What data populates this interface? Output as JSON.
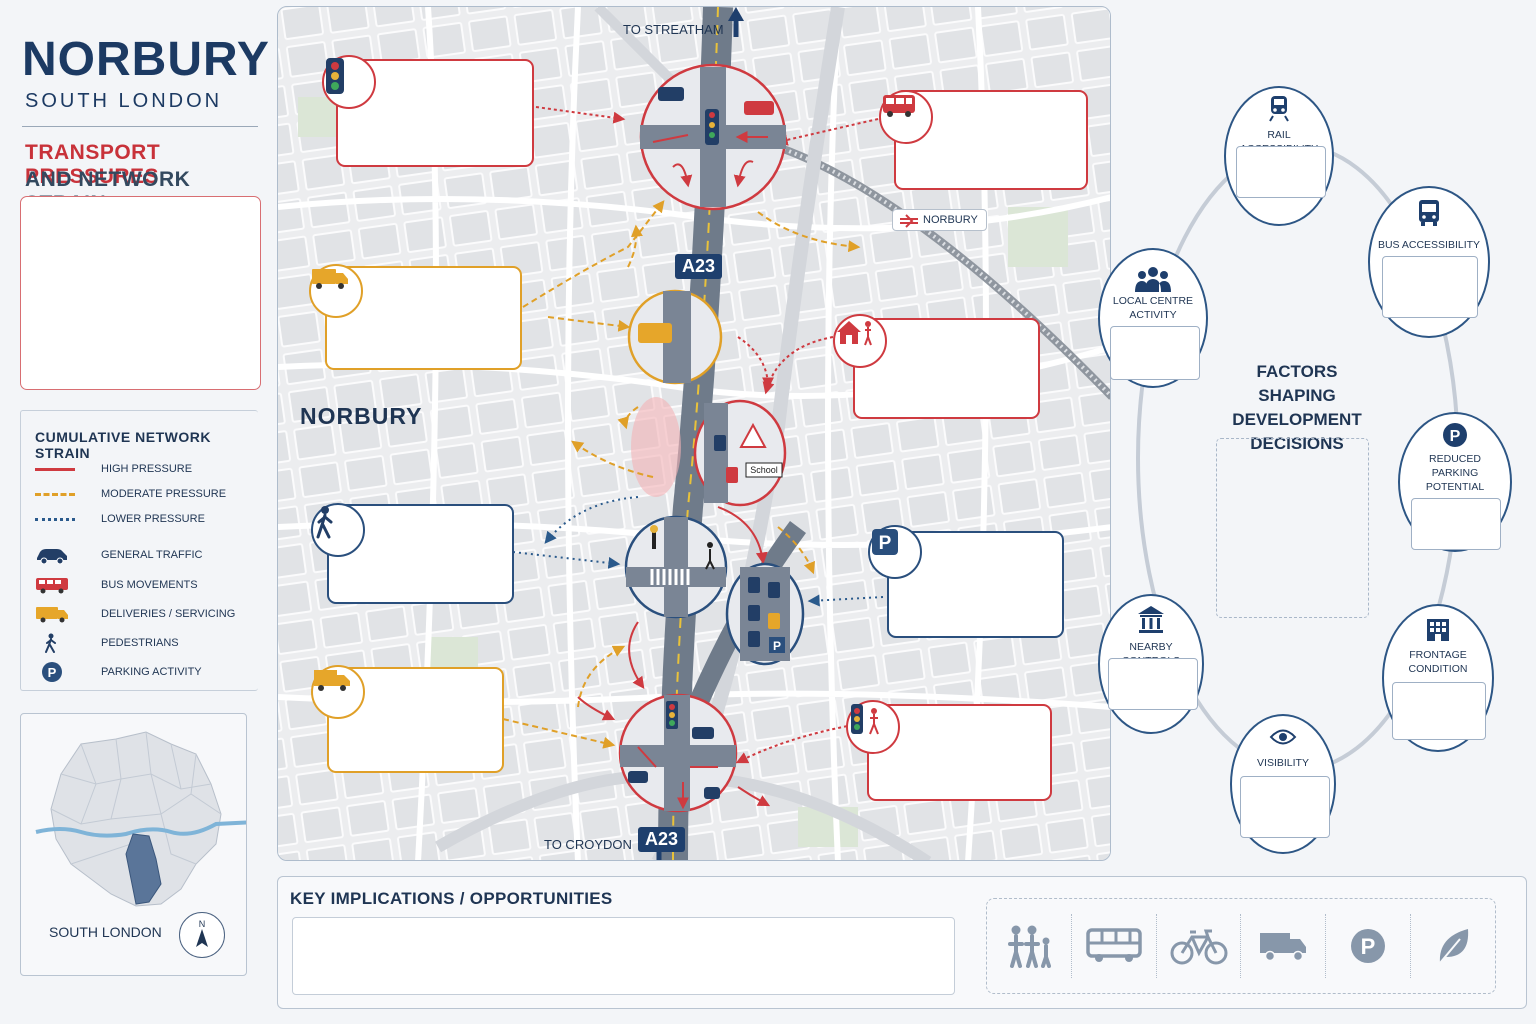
{
  "header": {
    "title": "NORBURY",
    "subtitle": "SOUTH LONDON",
    "heading_red": "TRANSPORT PRESSURES",
    "heading_blue": "AND NETWORK STRAIN"
  },
  "legend": {
    "title": "CUMULATIVE NETWORK STRAIN",
    "items": [
      {
        "label": "HIGH PRESSURE",
        "icon": "solid-red-line",
        "color": "#cf3a40"
      },
      {
        "label": "MODERATE PRESSURE",
        "icon": "dashed-orange-line",
        "color": "#e0a028"
      },
      {
        "label": "LOWER PRESSURE",
        "icon": "dotted-blue-line",
        "color": "#2a5a8c"
      },
      {
        "label": "GENERAL TRAFFIC",
        "icon": "car-icon",
        "color": "#2a4f7d"
      },
      {
        "label": "BUS MOVEMENTS",
        "icon": "bus-icon",
        "color": "#cf3a40"
      },
      {
        "label": "DELIVERIES / SERVICING",
        "icon": "van-icon",
        "color": "#e0a028"
      },
      {
        "label": "PEDESTRIANS",
        "icon": "pedestrian-icon",
        "color": "#2a4f7d"
      },
      {
        "label": "PARKING ACTIVITY",
        "icon": "parking-icon",
        "color": "#2a4f7d"
      }
    ]
  },
  "minimap": {
    "label": "SOUTH LONDON",
    "north_label": "N"
  },
  "map": {
    "place_name": "NORBURY",
    "to_north": "TO STREATHAM",
    "to_south": "TO CROYDON",
    "road_mid": "A23",
    "road_bottom": "A23",
    "station": "NORBURY",
    "school_sign": "School",
    "callouts": [
      {
        "id": "signals-north",
        "color": "red",
        "icon": "traffic-light-icon"
      },
      {
        "id": "bus-north",
        "color": "red",
        "icon": "bus-icon"
      },
      {
        "id": "deliveries-north",
        "color": "orange",
        "icon": "van-icon"
      },
      {
        "id": "school-residential",
        "color": "red",
        "icon": "house-family-icon"
      },
      {
        "id": "pedestrian-crossing",
        "color": "blue",
        "icon": "pedestrian-icon"
      },
      {
        "id": "parking",
        "color": "blue",
        "icon": "parking-icon"
      },
      {
        "id": "deliveries-south",
        "color": "orange",
        "icon": "truck-icon"
      },
      {
        "id": "signals-south",
        "color": "red",
        "icon": "signal-pedestrian-icon"
      }
    ]
  },
  "factors": {
    "title": "FACTORS SHAPING DEVELOPMENT DECISIONS",
    "items": [
      {
        "label": "RAIL ACCESSIBILITY",
        "icon": "train-icon"
      },
      {
        "label": "BUS ACCESSIBILITY",
        "icon": "bus-front-icon"
      },
      {
        "label": "LOCAL CENTRE ACTIVITY",
        "icon": "people-group-icon"
      },
      {
        "label": "REDUCED PARKING POTENTIAL",
        "icon": "parking-icon"
      },
      {
        "label": "NEARBY CONTROLS",
        "icon": "civic-building-icon"
      },
      {
        "label": "FRONTAGE CONDITION",
        "icon": "building-icon"
      },
      {
        "label": "VISIBILITY",
        "icon": "eye-icon"
      }
    ]
  },
  "implications": {
    "title": "KEY IMPLICATIONS / OPPORTUNITIES",
    "icons": [
      "family-icon",
      "bus-icon",
      "bicycle-icon",
      "truck-icon",
      "parking-icon",
      "leaf-icon"
    ]
  }
}
